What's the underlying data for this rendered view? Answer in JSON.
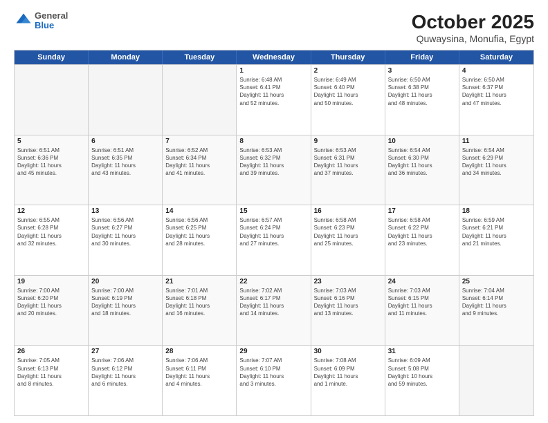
{
  "header": {
    "logo": {
      "general": "General",
      "blue": "Blue"
    },
    "title": "October 2025",
    "location": "Quwaysina, Monufia, Egypt"
  },
  "weekdays": [
    "Sunday",
    "Monday",
    "Tuesday",
    "Wednesday",
    "Thursday",
    "Friday",
    "Saturday"
  ],
  "rows": [
    [
      {
        "day": "",
        "info": "",
        "empty": true
      },
      {
        "day": "",
        "info": "",
        "empty": true
      },
      {
        "day": "",
        "info": "",
        "empty": true
      },
      {
        "day": "1",
        "info": "Sunrise: 6:48 AM\nSunset: 6:41 PM\nDaylight: 11 hours\nand 52 minutes.",
        "empty": false
      },
      {
        "day": "2",
        "info": "Sunrise: 6:49 AM\nSunset: 6:40 PM\nDaylight: 11 hours\nand 50 minutes.",
        "empty": false
      },
      {
        "day": "3",
        "info": "Sunrise: 6:50 AM\nSunset: 6:38 PM\nDaylight: 11 hours\nand 48 minutes.",
        "empty": false
      },
      {
        "day": "4",
        "info": "Sunrise: 6:50 AM\nSunset: 6:37 PM\nDaylight: 11 hours\nand 47 minutes.",
        "empty": false
      }
    ],
    [
      {
        "day": "5",
        "info": "Sunrise: 6:51 AM\nSunset: 6:36 PM\nDaylight: 11 hours\nand 45 minutes.",
        "empty": false
      },
      {
        "day": "6",
        "info": "Sunrise: 6:51 AM\nSunset: 6:35 PM\nDaylight: 11 hours\nand 43 minutes.",
        "empty": false
      },
      {
        "day": "7",
        "info": "Sunrise: 6:52 AM\nSunset: 6:34 PM\nDaylight: 11 hours\nand 41 minutes.",
        "empty": false
      },
      {
        "day": "8",
        "info": "Sunrise: 6:53 AM\nSunset: 6:32 PM\nDaylight: 11 hours\nand 39 minutes.",
        "empty": false
      },
      {
        "day": "9",
        "info": "Sunrise: 6:53 AM\nSunset: 6:31 PM\nDaylight: 11 hours\nand 37 minutes.",
        "empty": false
      },
      {
        "day": "10",
        "info": "Sunrise: 6:54 AM\nSunset: 6:30 PM\nDaylight: 11 hours\nand 36 minutes.",
        "empty": false
      },
      {
        "day": "11",
        "info": "Sunrise: 6:54 AM\nSunset: 6:29 PM\nDaylight: 11 hours\nand 34 minutes.",
        "empty": false
      }
    ],
    [
      {
        "day": "12",
        "info": "Sunrise: 6:55 AM\nSunset: 6:28 PM\nDaylight: 11 hours\nand 32 minutes.",
        "empty": false
      },
      {
        "day": "13",
        "info": "Sunrise: 6:56 AM\nSunset: 6:27 PM\nDaylight: 11 hours\nand 30 minutes.",
        "empty": false
      },
      {
        "day": "14",
        "info": "Sunrise: 6:56 AM\nSunset: 6:25 PM\nDaylight: 11 hours\nand 28 minutes.",
        "empty": false
      },
      {
        "day": "15",
        "info": "Sunrise: 6:57 AM\nSunset: 6:24 PM\nDaylight: 11 hours\nand 27 minutes.",
        "empty": false
      },
      {
        "day": "16",
        "info": "Sunrise: 6:58 AM\nSunset: 6:23 PM\nDaylight: 11 hours\nand 25 minutes.",
        "empty": false
      },
      {
        "day": "17",
        "info": "Sunrise: 6:58 AM\nSunset: 6:22 PM\nDaylight: 11 hours\nand 23 minutes.",
        "empty": false
      },
      {
        "day": "18",
        "info": "Sunrise: 6:59 AM\nSunset: 6:21 PM\nDaylight: 11 hours\nand 21 minutes.",
        "empty": false
      }
    ],
    [
      {
        "day": "19",
        "info": "Sunrise: 7:00 AM\nSunset: 6:20 PM\nDaylight: 11 hours\nand 20 minutes.",
        "empty": false
      },
      {
        "day": "20",
        "info": "Sunrise: 7:00 AM\nSunset: 6:19 PM\nDaylight: 11 hours\nand 18 minutes.",
        "empty": false
      },
      {
        "day": "21",
        "info": "Sunrise: 7:01 AM\nSunset: 6:18 PM\nDaylight: 11 hours\nand 16 minutes.",
        "empty": false
      },
      {
        "day": "22",
        "info": "Sunrise: 7:02 AM\nSunset: 6:17 PM\nDaylight: 11 hours\nand 14 minutes.",
        "empty": false
      },
      {
        "day": "23",
        "info": "Sunrise: 7:03 AM\nSunset: 6:16 PM\nDaylight: 11 hours\nand 13 minutes.",
        "empty": false
      },
      {
        "day": "24",
        "info": "Sunrise: 7:03 AM\nSunset: 6:15 PM\nDaylight: 11 hours\nand 11 minutes.",
        "empty": false
      },
      {
        "day": "25",
        "info": "Sunrise: 7:04 AM\nSunset: 6:14 PM\nDaylight: 11 hours\nand 9 minutes.",
        "empty": false
      }
    ],
    [
      {
        "day": "26",
        "info": "Sunrise: 7:05 AM\nSunset: 6:13 PM\nDaylight: 11 hours\nand 8 minutes.",
        "empty": false
      },
      {
        "day": "27",
        "info": "Sunrise: 7:06 AM\nSunset: 6:12 PM\nDaylight: 11 hours\nand 6 minutes.",
        "empty": false
      },
      {
        "day": "28",
        "info": "Sunrise: 7:06 AM\nSunset: 6:11 PM\nDaylight: 11 hours\nand 4 minutes.",
        "empty": false
      },
      {
        "day": "29",
        "info": "Sunrise: 7:07 AM\nSunset: 6:10 PM\nDaylight: 11 hours\nand 3 minutes.",
        "empty": false
      },
      {
        "day": "30",
        "info": "Sunrise: 7:08 AM\nSunset: 6:09 PM\nDaylight: 11 hours\nand 1 minute.",
        "empty": false
      },
      {
        "day": "31",
        "info": "Sunrise: 6:09 AM\nSunset: 5:08 PM\nDaylight: 10 hours\nand 59 minutes.",
        "empty": false
      },
      {
        "day": "",
        "info": "",
        "empty": true
      }
    ]
  ]
}
